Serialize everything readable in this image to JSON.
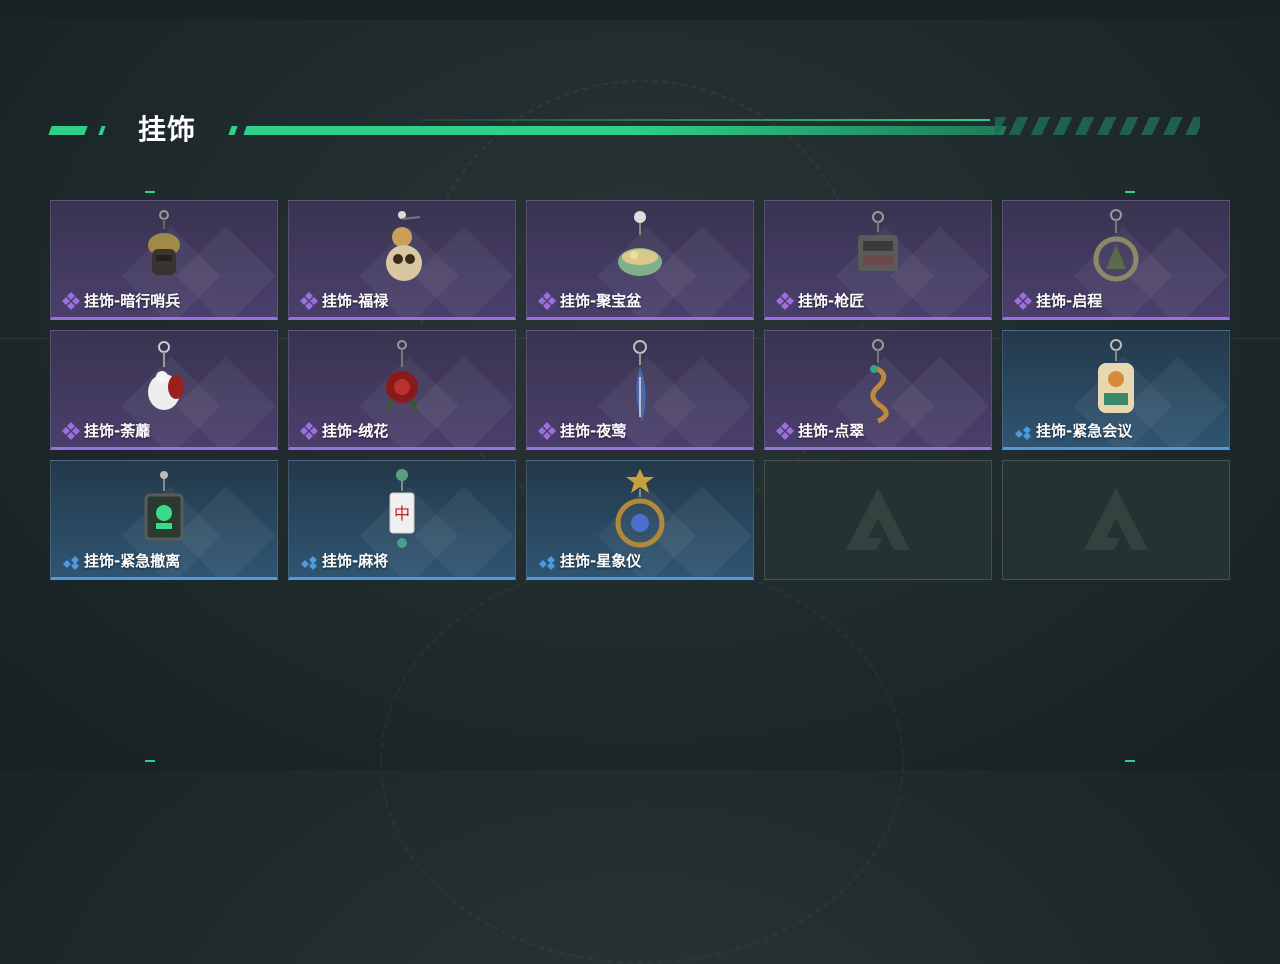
{
  "section": {
    "title": "挂饰"
  },
  "colors": {
    "accent": "#2ed18a",
    "purple_rarity": "#9c6fe0",
    "blue_rarity": "#4d9ae0"
  },
  "items": [
    {
      "label": "挂饰-暗行哨兵",
      "rarity": "purple",
      "icon": "sentry-charm-icon"
    },
    {
      "label": "挂饰-福禄",
      "rarity": "purple",
      "icon": "gourd-charm-icon"
    },
    {
      "label": "挂饰-聚宝盆",
      "rarity": "purple",
      "icon": "treasure-bowl-charm-icon"
    },
    {
      "label": "挂饰-枪匠",
      "rarity": "purple",
      "icon": "gunsmith-charm-icon"
    },
    {
      "label": "挂饰-启程",
      "rarity": "purple",
      "icon": "departure-charm-icon"
    },
    {
      "label": "挂饰-荼蘼",
      "rarity": "purple",
      "icon": "flower-doll-charm-icon"
    },
    {
      "label": "挂饰-绒花",
      "rarity": "purple",
      "icon": "rose-charm-icon"
    },
    {
      "label": "挂饰-夜莺",
      "rarity": "purple",
      "icon": "feather-charm-icon"
    },
    {
      "label": "挂饰-点翠",
      "rarity": "purple",
      "icon": "serpent-charm-icon"
    },
    {
      "label": "挂饰-紧急会议",
      "rarity": "blue",
      "icon": "meeting-charm-icon"
    },
    {
      "label": "挂饰-紧急撤离",
      "rarity": "blue",
      "icon": "evac-charm-icon"
    },
    {
      "label": "挂饰-麻将",
      "rarity": "blue",
      "icon": "mahjong-charm-icon"
    },
    {
      "label": "挂饰-星象仪",
      "rarity": "blue",
      "icon": "astrolabe-charm-icon"
    }
  ],
  "empty_slots": 2
}
